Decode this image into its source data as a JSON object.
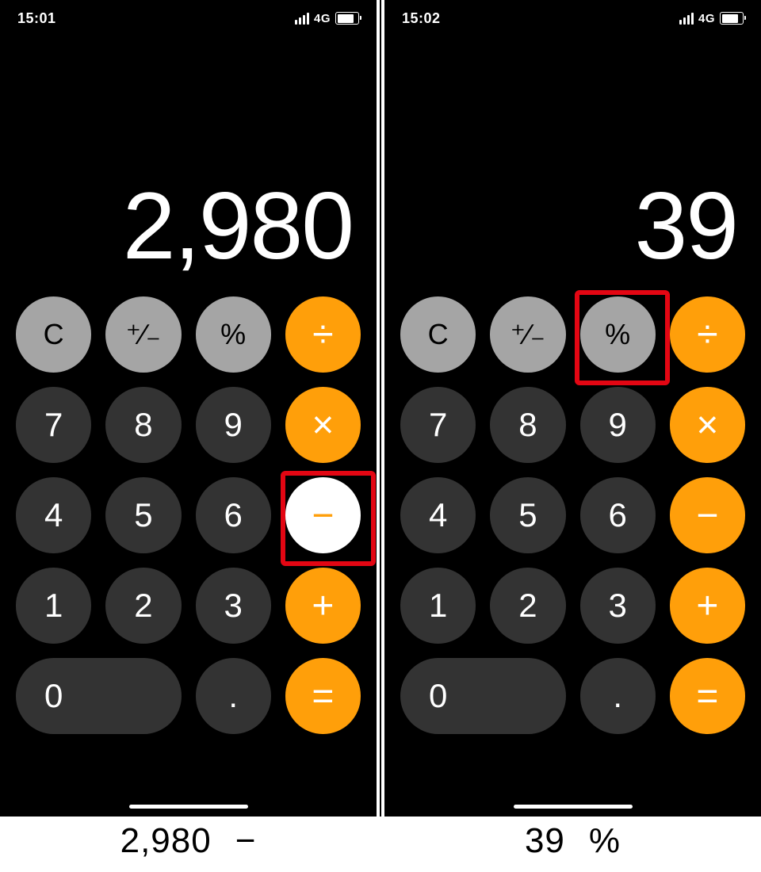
{
  "screens": [
    {
      "status": {
        "time": "15:01",
        "network": "4G"
      },
      "display_value": "2,980",
      "highlight_key": "minus",
      "minus_active": true,
      "caption_value": "2,980",
      "caption_op": "−"
    },
    {
      "status": {
        "time": "15:02",
        "network": "4G"
      },
      "display_value": "39",
      "highlight_key": "percent",
      "minus_active": false,
      "caption_value": "39",
      "caption_op": "%"
    }
  ],
  "keys": {
    "clear": "C",
    "sign": "⁺∕₋",
    "percent": "%",
    "divide": "÷",
    "multiply": "×",
    "minus": "−",
    "plus": "+",
    "equals": "=",
    "decimal": ".",
    "d0": "0",
    "d1": "1",
    "d2": "2",
    "d3": "3",
    "d4": "4",
    "d5": "5",
    "d6": "6",
    "d7": "7",
    "d8": "8",
    "d9": "9"
  }
}
